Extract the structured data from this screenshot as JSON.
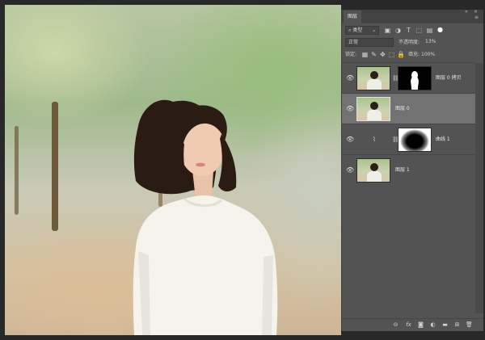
{
  "panel": {
    "tab_label": "图层",
    "collapse_glyph": "«",
    "close_glyph": "×",
    "menu_glyph": "≡",
    "filter": {
      "kind_label": "类型",
      "search_glyph": "⌕",
      "dropdown_glyph": "⌄"
    },
    "filter_icons": [
      "image-filter-icon",
      "adjustment-filter-icon",
      "type-filter-icon",
      "shape-filter-icon",
      "smart-object-filter-icon",
      "filter-toggle-icon"
    ],
    "blend": {
      "mode": "正常",
      "opacity_label": "不透明度:",
      "opacity_value": "13%"
    },
    "lock": {
      "label": "锁定:",
      "fill_label": "填充:",
      "fill_value": "100%"
    },
    "lock_icons": [
      "lock-transparent-icon",
      "lock-paint-icon",
      "lock-move-icon",
      "lock-artboard-icon",
      "lock-all-icon"
    ],
    "layers": [
      {
        "name": "图层 0 拷贝",
        "thumb": "photo",
        "mask": true,
        "selected": false
      },
      {
        "name": "图层 0",
        "thumb": "photo",
        "mask": false,
        "selected": true
      },
      {
        "name": "曲线 1",
        "thumb": "adjustment",
        "mask": true,
        "selected": false
      },
      {
        "name": "图层 1",
        "thumb": "photo",
        "mask": false,
        "selected": false
      }
    ],
    "footer_icons": [
      "link-icon",
      "fx-icon",
      "add-mask-icon",
      "adjustment-layer-icon",
      "folder-icon",
      "new-layer-icon",
      "trash-icon"
    ],
    "footer_glyphs": {
      "link": "⊝",
      "fx": "fx",
      "mask": "◙",
      "adj": "◐",
      "folder": "▬",
      "new": "⊞",
      "trash": "🗑"
    }
  },
  "colors": {
    "panel_bg": "#535353",
    "selected_row": "#727272",
    "tab_bg": "#424242"
  }
}
